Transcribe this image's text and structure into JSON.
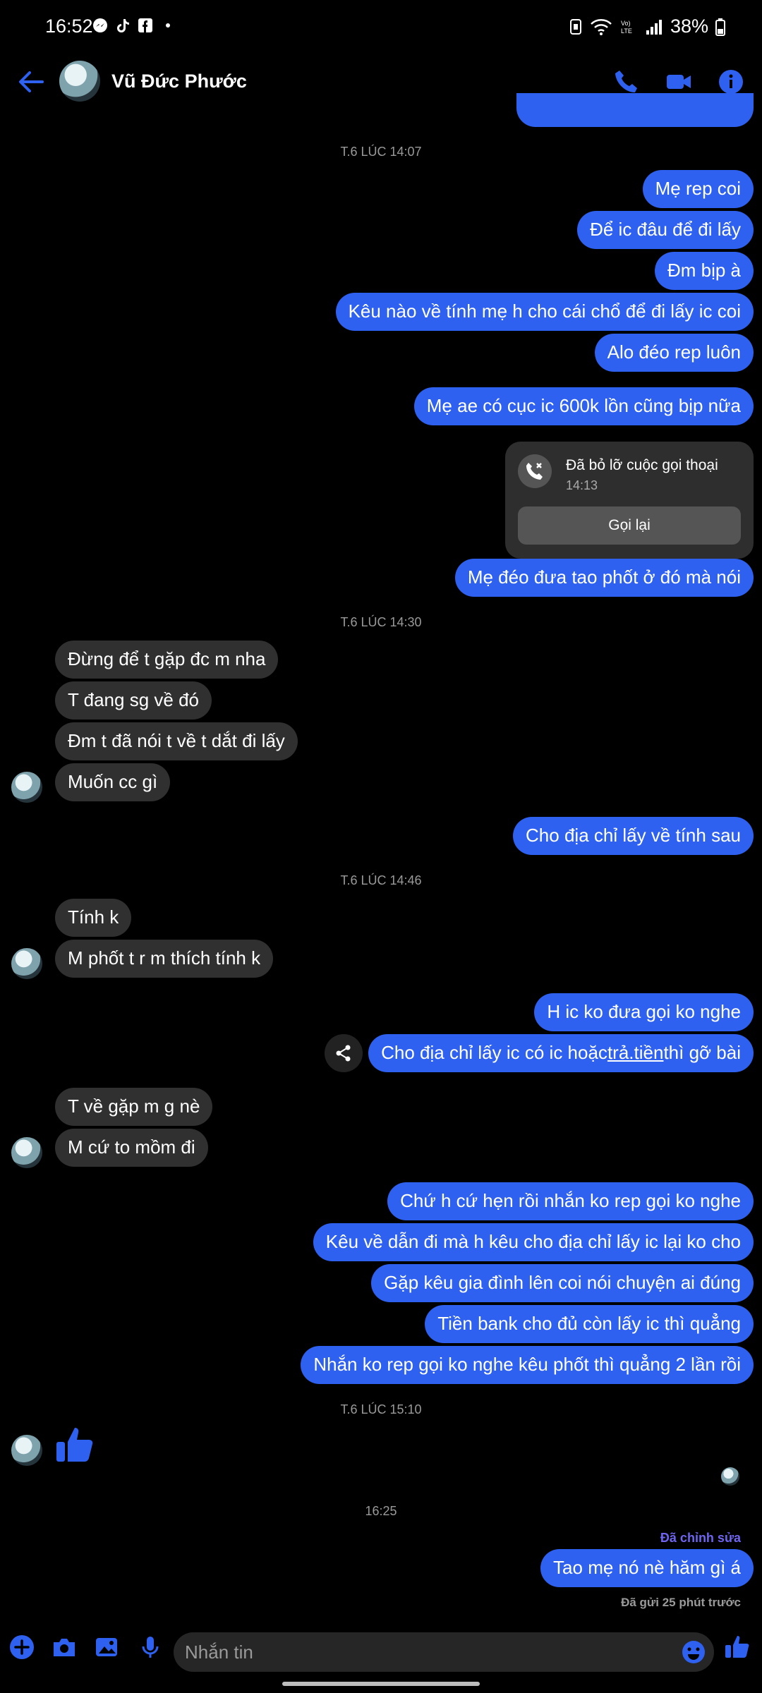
{
  "status_bar": {
    "time": "16:52",
    "battery": "38%"
  },
  "header": {
    "name": "Vũ Đức Phước"
  },
  "colors": {
    "accent": "#2f61f0",
    "incoming": "#303030",
    "background": "#000000"
  },
  "timestamps": {
    "t1": "T.6 LÚC 14:07",
    "t2": "T.6 LÚC 14:30",
    "t3": "T.6 LÚC 14:46",
    "t4": "T.6 LÚC 15:10",
    "t5": "16:25"
  },
  "messages": {
    "m1": "Mẹ rep coi",
    "m2": "Để ic đâu để đi lấy",
    "m3": "Đm bịp à",
    "m4": "Kêu nào về tính mẹ h cho cái chổ để đi lấy ic coi",
    "m5": "Alo đéo rep luôn",
    "m6": "Mẹ ae có cục ic 600k lồn cũng bịp nữa",
    "m7": "Mẹ đéo đưa tao phốt ở đó mà nói",
    "m8": "Đừng để t gặp đc m nha",
    "m9": "T đang sg về đó",
    "m10": "Đm t đã nói t về t dắt đi lấy",
    "m11": "Muốn cc gì",
    "m12": "Cho địa chỉ lấy về tính sau",
    "m13": "Tính k",
    "m14": "M phốt t r m thích tính k",
    "m15": "H ic ko đưa gọi ko nghe",
    "m16a": "Cho địa chỉ lấy ic có ic hoặc ",
    "m16b": "trả.tiền",
    "m16c": " thì gỡ bài",
    "m17": "T về gặp m g nè",
    "m18": "M cứ to mồm đi",
    "m19": "Chứ h cứ hẹn rồi nhắn ko rep gọi ko nghe",
    "m20": "Kêu về dẫn đi mà h kêu cho địa chỉ lấy ic lại ko cho",
    "m21": "Gặp kêu gia đình lên coi nói chuyện ai đúng",
    "m22": "Tiền bank cho đủ còn lấy ic thì quẳng",
    "m23": "Nhắn ko rep gọi ko nghe kêu phốt thì quẳng 2 lần rồi",
    "m24": "Tao mẹ nó nè hăm gì á"
  },
  "call_card": {
    "title": "Đã bỏ lỡ cuộc gọi thoại",
    "time": "14:13",
    "button": "Gọi lại"
  },
  "edited_label": "Đã chỉnh sửa",
  "sent_label": "Đã gửi 25 phút trước",
  "composer": {
    "placeholder": "Nhắn tin"
  }
}
